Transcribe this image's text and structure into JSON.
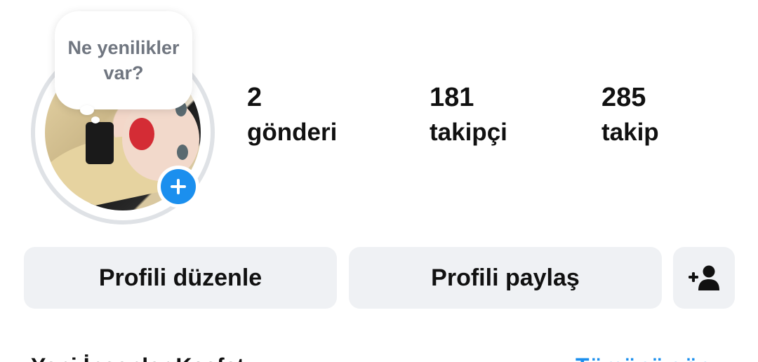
{
  "profile": {
    "note_bubble_text": "Ne yenilikler var?",
    "add_story_icon": "plus-icon",
    "colors": {
      "accent": "#1b8fee",
      "button_bg": "#eff1f4",
      "note_text": "#707680"
    }
  },
  "stats": {
    "posts": {
      "count": "2",
      "label": "gönderi"
    },
    "followers": {
      "count": "181",
      "label": "takipçi"
    },
    "following": {
      "count": "285",
      "label": "takip"
    }
  },
  "actions": {
    "edit_profile": "Profili düzenle",
    "share_profile": "Profili paylaş",
    "discover_people_icon": "add-person-icon"
  },
  "discover": {
    "title": "Yeni İnsanlar Keşfet",
    "see_all": "Tümünü gör"
  }
}
